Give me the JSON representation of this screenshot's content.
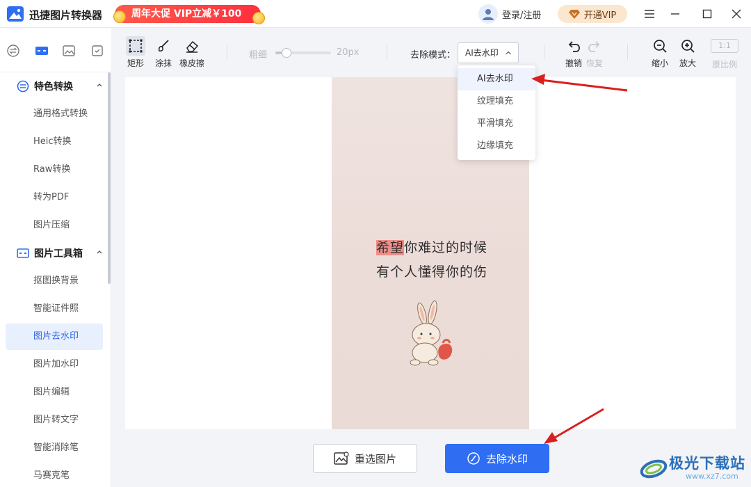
{
  "app": {
    "title": "迅捷图片转换器",
    "promo": "周年大促 VIP立减￥100",
    "login": "登录/注册",
    "vip": "开通VIP"
  },
  "sidebar": {
    "groups": [
      {
        "label": "特色转换",
        "items": [
          "通用格式转换",
          "Heic转换",
          "Raw转换",
          "转为PDF",
          "图片压缩"
        ]
      },
      {
        "label": "图片工具箱",
        "items": [
          "抠图换背景",
          "智能证件照",
          "图片去水印",
          "图片加水印",
          "图片编辑",
          "图片转文字",
          "智能消除笔",
          "马赛克笔"
        ]
      }
    ],
    "active_item": "图片去水印"
  },
  "toolbar": {
    "rect": "矩形",
    "brush": "涂抹",
    "eraser": "橡皮擦",
    "thickness_label": "粗细",
    "thickness_value": "20px",
    "mode_label": "去除模式：",
    "mode_selected": "AI去水印",
    "undo": "撤销",
    "redo": "恢复",
    "zoom_out": "缩小",
    "zoom_in": "放大",
    "ratio_box": "1:1",
    "ratio_label": "原比例",
    "thickness_fraction": 0.2
  },
  "dropdown": {
    "options": [
      "AI去水印",
      "纹理填充",
      "平滑填充",
      "边缘填充"
    ]
  },
  "image": {
    "line1_highlight": "希望",
    "line1_rest": "你难过的时候",
    "line2": "有个人懂得你的伤"
  },
  "buttons": {
    "reselect": "重选图片",
    "remove": "去除水印"
  },
  "watermark": {
    "name": "极光下载站",
    "url": "www.xz7.com"
  },
  "colors": {
    "accent": "#2f6ef2",
    "active_bg": "#e8effd",
    "promo": "#ff3f43",
    "arrow": "#d9201e"
  }
}
